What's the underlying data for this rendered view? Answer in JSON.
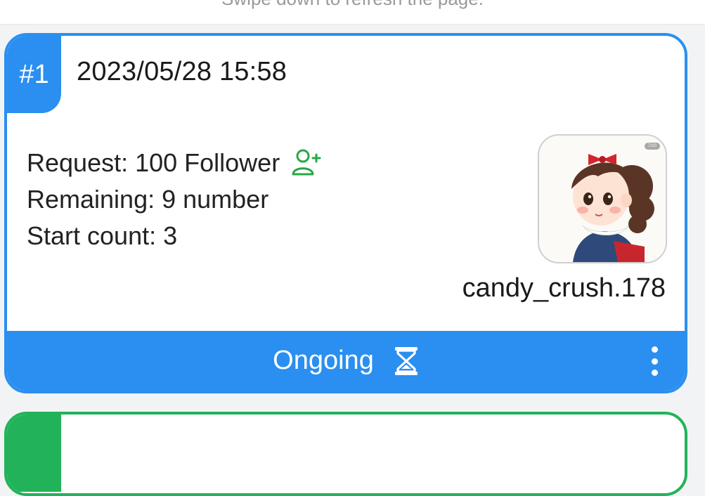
{
  "header": {
    "refresh_hint": "Swipe down to refresh the page."
  },
  "order": {
    "index": "#1",
    "datetime": "2023/05/28 15:58",
    "request": "Request: 100 Follower",
    "remaining": "Remaining: 9 number",
    "start_count": "Start count: 3",
    "username": "candy_crush.178",
    "avatar_tag": "7/10",
    "status": "Ongoing"
  },
  "icons": {
    "request": "add-follower-icon",
    "status": "hourglass-icon",
    "menu": "more-vertical-icon"
  },
  "colors": {
    "accent_blue": "#2a8ff0",
    "follower_icon_green": "#27a844",
    "next_card_green": "#22b35a"
  }
}
